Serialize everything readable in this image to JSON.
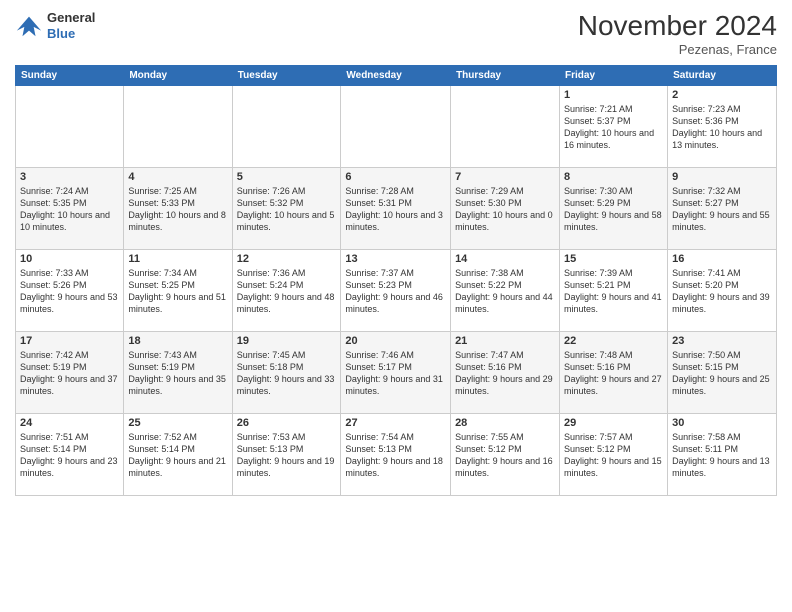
{
  "header": {
    "logo": {
      "general": "General",
      "blue": "Blue"
    },
    "title": "November 2024",
    "location": "Pezenas, France"
  },
  "weekdays": [
    "Sunday",
    "Monday",
    "Tuesday",
    "Wednesday",
    "Thursday",
    "Friday",
    "Saturday"
  ],
  "weeks": [
    [
      {
        "day": "",
        "info": ""
      },
      {
        "day": "",
        "info": ""
      },
      {
        "day": "",
        "info": ""
      },
      {
        "day": "",
        "info": ""
      },
      {
        "day": "",
        "info": ""
      },
      {
        "day": "1",
        "info": "Sunrise: 7:21 AM\nSunset: 5:37 PM\nDaylight: 10 hours and 16 minutes."
      },
      {
        "day": "2",
        "info": "Sunrise: 7:23 AM\nSunset: 5:36 PM\nDaylight: 10 hours and 13 minutes."
      }
    ],
    [
      {
        "day": "3",
        "info": "Sunrise: 7:24 AM\nSunset: 5:35 PM\nDaylight: 10 hours and 10 minutes."
      },
      {
        "day": "4",
        "info": "Sunrise: 7:25 AM\nSunset: 5:33 PM\nDaylight: 10 hours and 8 minutes."
      },
      {
        "day": "5",
        "info": "Sunrise: 7:26 AM\nSunset: 5:32 PM\nDaylight: 10 hours and 5 minutes."
      },
      {
        "day": "6",
        "info": "Sunrise: 7:28 AM\nSunset: 5:31 PM\nDaylight: 10 hours and 3 minutes."
      },
      {
        "day": "7",
        "info": "Sunrise: 7:29 AM\nSunset: 5:30 PM\nDaylight: 10 hours and 0 minutes."
      },
      {
        "day": "8",
        "info": "Sunrise: 7:30 AM\nSunset: 5:29 PM\nDaylight: 9 hours and 58 minutes."
      },
      {
        "day": "9",
        "info": "Sunrise: 7:32 AM\nSunset: 5:27 PM\nDaylight: 9 hours and 55 minutes."
      }
    ],
    [
      {
        "day": "10",
        "info": "Sunrise: 7:33 AM\nSunset: 5:26 PM\nDaylight: 9 hours and 53 minutes."
      },
      {
        "day": "11",
        "info": "Sunrise: 7:34 AM\nSunset: 5:25 PM\nDaylight: 9 hours and 51 minutes."
      },
      {
        "day": "12",
        "info": "Sunrise: 7:36 AM\nSunset: 5:24 PM\nDaylight: 9 hours and 48 minutes."
      },
      {
        "day": "13",
        "info": "Sunrise: 7:37 AM\nSunset: 5:23 PM\nDaylight: 9 hours and 46 minutes."
      },
      {
        "day": "14",
        "info": "Sunrise: 7:38 AM\nSunset: 5:22 PM\nDaylight: 9 hours and 44 minutes."
      },
      {
        "day": "15",
        "info": "Sunrise: 7:39 AM\nSunset: 5:21 PM\nDaylight: 9 hours and 41 minutes."
      },
      {
        "day": "16",
        "info": "Sunrise: 7:41 AM\nSunset: 5:20 PM\nDaylight: 9 hours and 39 minutes."
      }
    ],
    [
      {
        "day": "17",
        "info": "Sunrise: 7:42 AM\nSunset: 5:19 PM\nDaylight: 9 hours and 37 minutes."
      },
      {
        "day": "18",
        "info": "Sunrise: 7:43 AM\nSunset: 5:19 PM\nDaylight: 9 hours and 35 minutes."
      },
      {
        "day": "19",
        "info": "Sunrise: 7:45 AM\nSunset: 5:18 PM\nDaylight: 9 hours and 33 minutes."
      },
      {
        "day": "20",
        "info": "Sunrise: 7:46 AM\nSunset: 5:17 PM\nDaylight: 9 hours and 31 minutes."
      },
      {
        "day": "21",
        "info": "Sunrise: 7:47 AM\nSunset: 5:16 PM\nDaylight: 9 hours and 29 minutes."
      },
      {
        "day": "22",
        "info": "Sunrise: 7:48 AM\nSunset: 5:16 PM\nDaylight: 9 hours and 27 minutes."
      },
      {
        "day": "23",
        "info": "Sunrise: 7:50 AM\nSunset: 5:15 PM\nDaylight: 9 hours and 25 minutes."
      }
    ],
    [
      {
        "day": "24",
        "info": "Sunrise: 7:51 AM\nSunset: 5:14 PM\nDaylight: 9 hours and 23 minutes."
      },
      {
        "day": "25",
        "info": "Sunrise: 7:52 AM\nSunset: 5:14 PM\nDaylight: 9 hours and 21 minutes."
      },
      {
        "day": "26",
        "info": "Sunrise: 7:53 AM\nSunset: 5:13 PM\nDaylight: 9 hours and 19 minutes."
      },
      {
        "day": "27",
        "info": "Sunrise: 7:54 AM\nSunset: 5:13 PM\nDaylight: 9 hours and 18 minutes."
      },
      {
        "day": "28",
        "info": "Sunrise: 7:55 AM\nSunset: 5:12 PM\nDaylight: 9 hours and 16 minutes."
      },
      {
        "day": "29",
        "info": "Sunrise: 7:57 AM\nSunset: 5:12 PM\nDaylight: 9 hours and 15 minutes."
      },
      {
        "day": "30",
        "info": "Sunrise: 7:58 AM\nSunset: 5:11 PM\nDaylight: 9 hours and 13 minutes."
      }
    ]
  ]
}
